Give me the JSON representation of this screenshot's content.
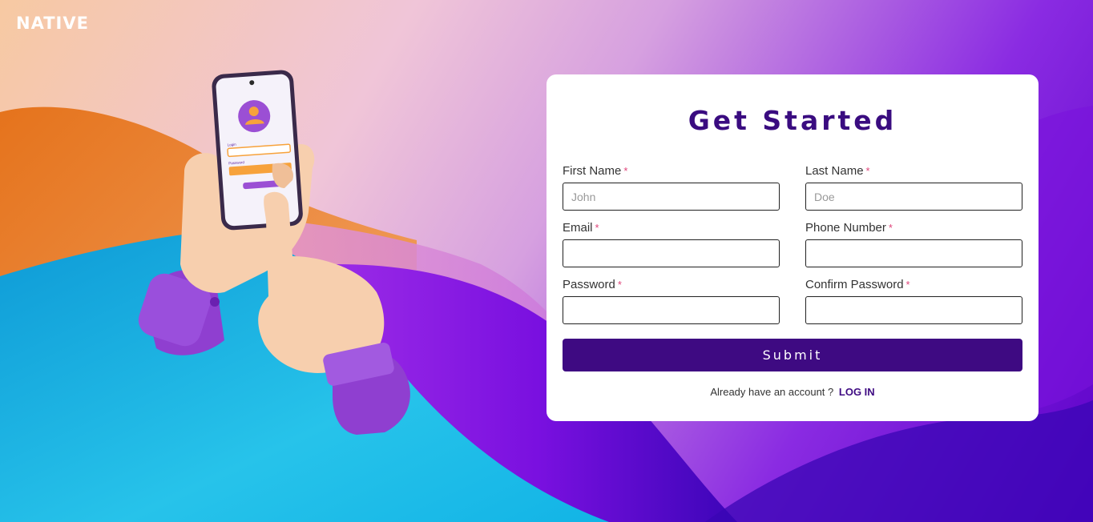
{
  "brand": {
    "logo_text": "NATIVE"
  },
  "form": {
    "title": "Get Started",
    "required_mark": "*",
    "fields": [
      {
        "label": "First Name",
        "placeholder": "John",
        "value": ""
      },
      {
        "label": "Last Name",
        "placeholder": "Doe",
        "value": ""
      },
      {
        "label": "Email",
        "placeholder": "",
        "value": ""
      },
      {
        "label": "Phone Number",
        "placeholder": "",
        "value": ""
      },
      {
        "label": "Password",
        "placeholder": "",
        "value": ""
      },
      {
        "label": "Confirm Password",
        "placeholder": "",
        "value": ""
      }
    ],
    "submit_label": "Submit",
    "login_prompt": "Already have an account ?",
    "login_link": "LOG IN"
  },
  "illustration": {
    "phone_login_label": "Login",
    "phone_password_label": "Password"
  },
  "colors": {
    "primary": "#3e0a82",
    "title": "#3a0c80",
    "required": "#e0457b",
    "background_orange": "#e8721e",
    "background_blue": "#17b0e0",
    "background_purple": "#8a1ee8"
  }
}
